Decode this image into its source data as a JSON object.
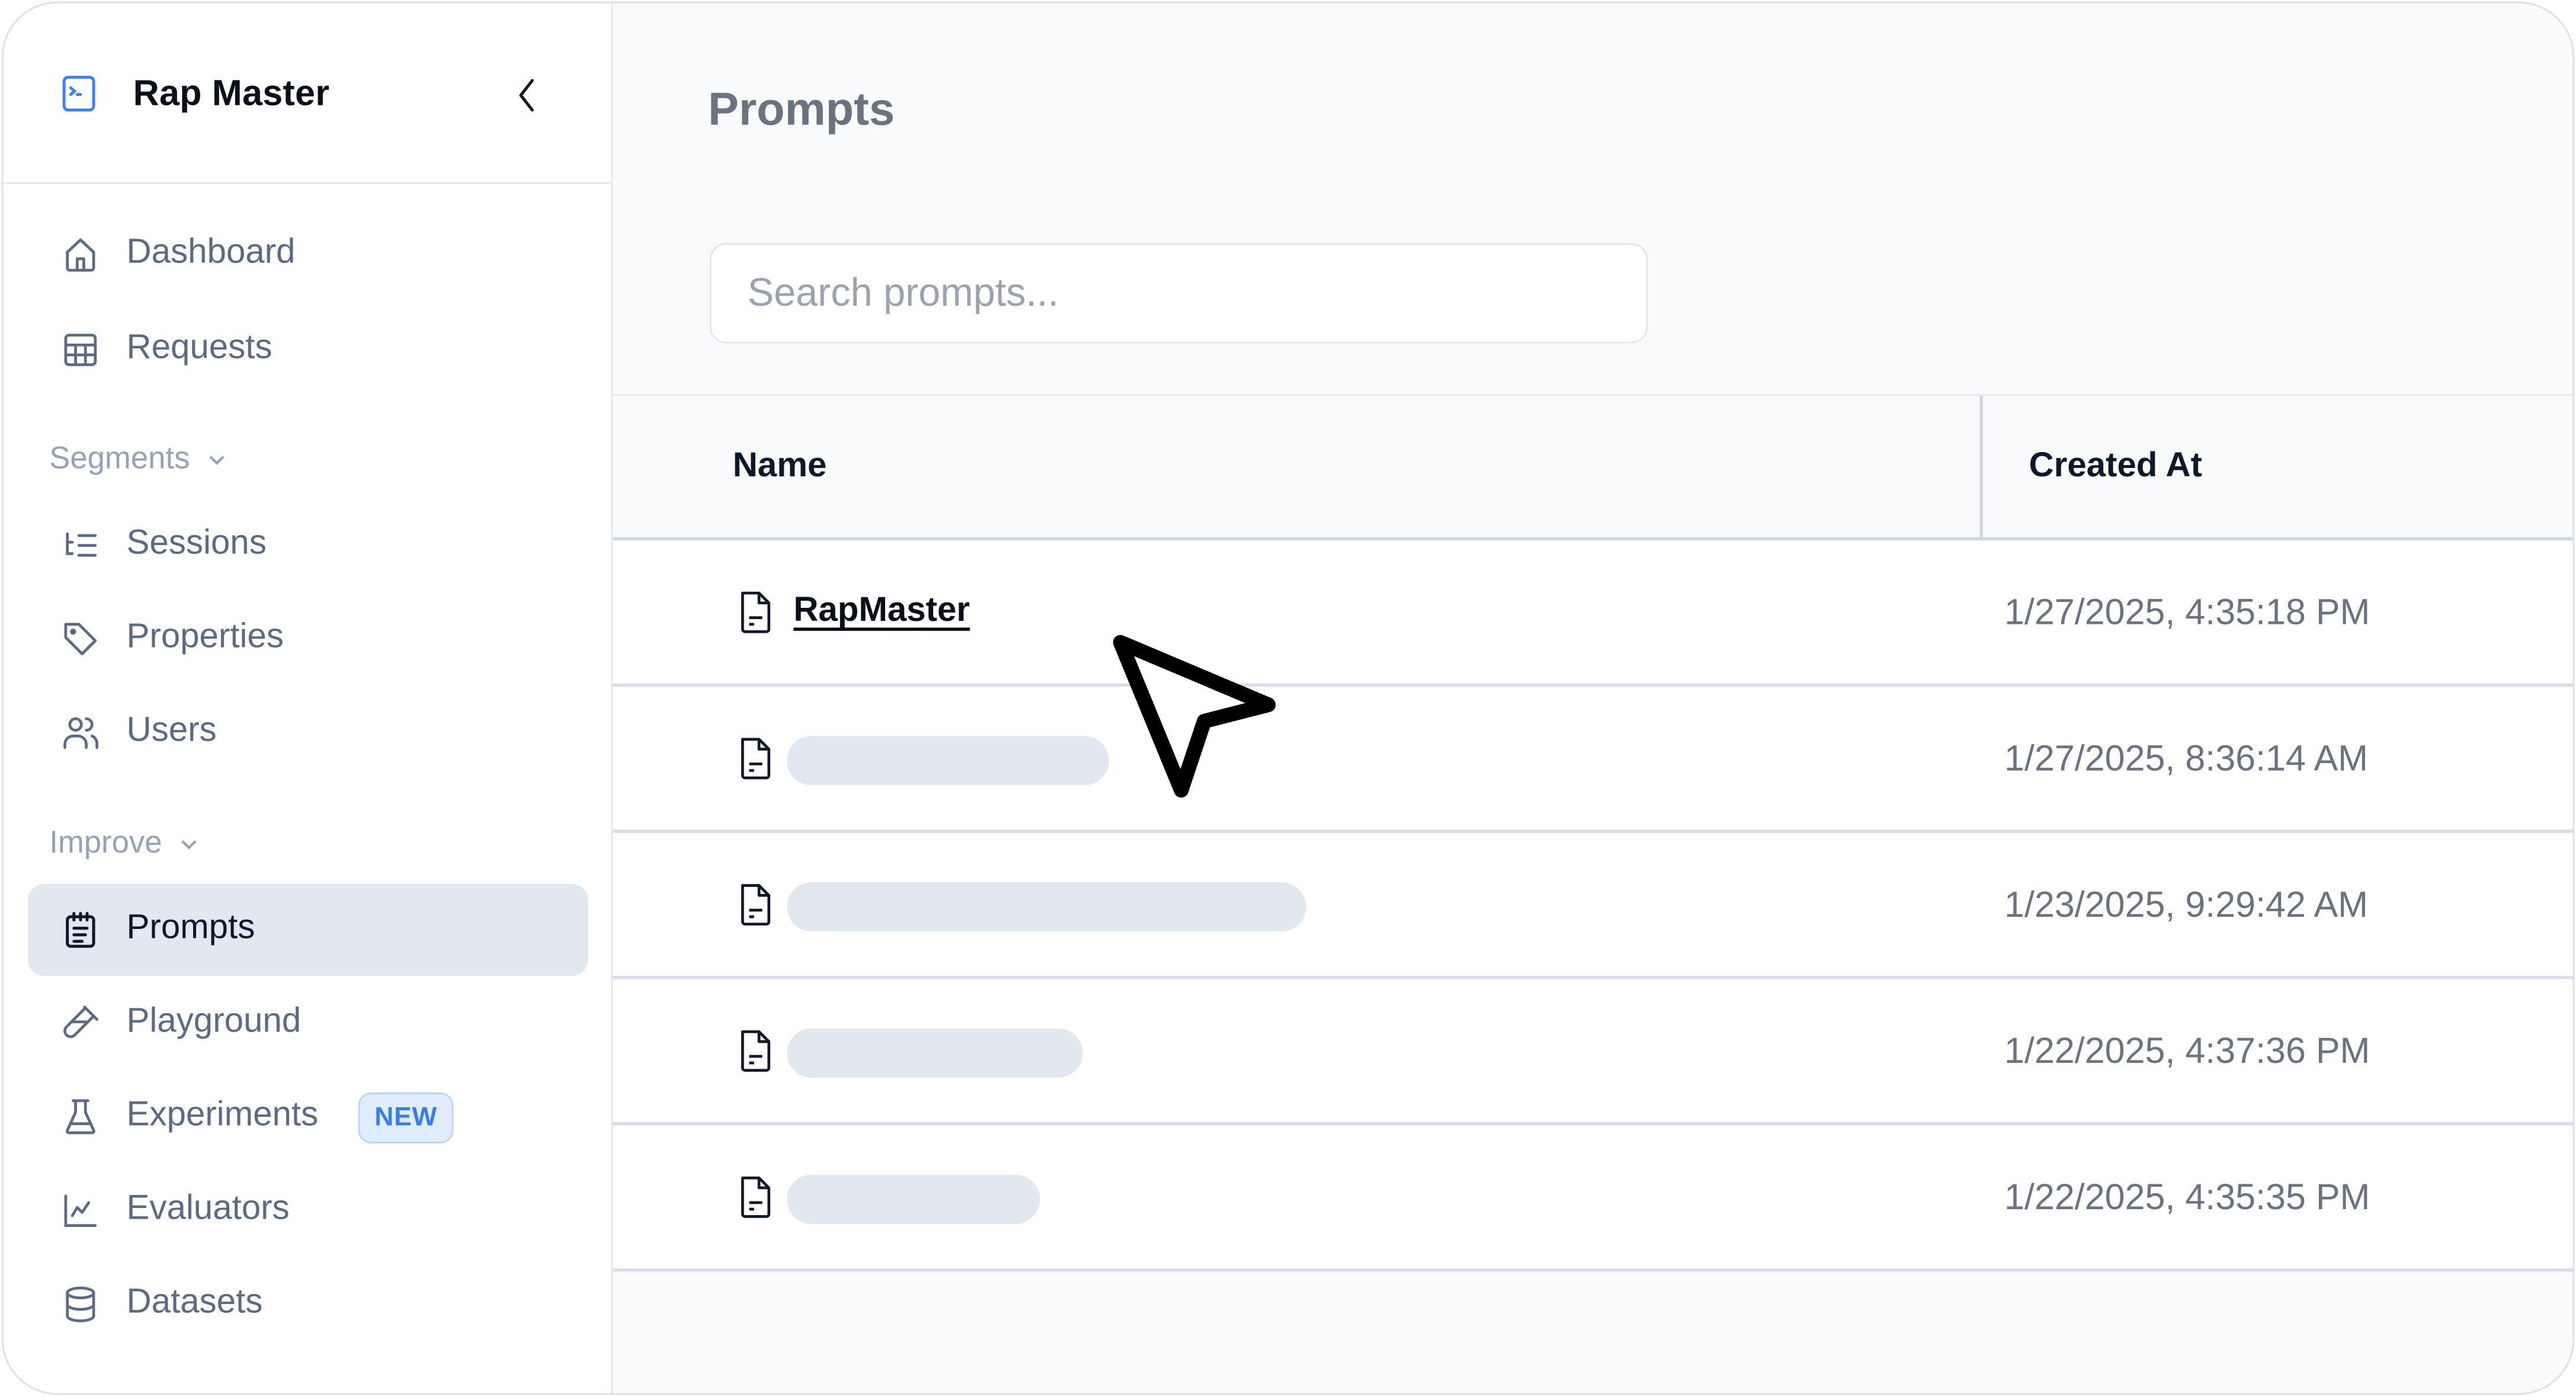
{
  "sidebar": {
    "brand": {
      "name": "Rap Master",
      "icon": "terminal-icon",
      "accent": "#3b82f6"
    },
    "collapse_icon": "chevron-left-icon",
    "items": [
      {
        "label": "Dashboard",
        "icon": "home-icon"
      },
      {
        "label": "Requests",
        "icon": "table-icon"
      },
      {
        "label": "Sessions",
        "icon": "list-tree-icon"
      },
      {
        "label": "Properties",
        "icon": "tag-icon"
      },
      {
        "label": "Users",
        "icon": "users-icon"
      },
      {
        "label": "Prompts",
        "icon": "notepad-icon",
        "active": true
      },
      {
        "label": "Playground",
        "icon": "test-tube-icon"
      },
      {
        "label": "Experiments",
        "icon": "flask-icon",
        "badge": "NEW"
      },
      {
        "label": "Evaluators",
        "icon": "line-chart-icon"
      },
      {
        "label": "Datasets",
        "icon": "database-icon"
      }
    ],
    "sections": [
      {
        "label": "Segments"
      },
      {
        "label": "Improve"
      }
    ]
  },
  "main": {
    "title": "Prompts",
    "search": {
      "placeholder": "Search prompts...",
      "value": ""
    },
    "table": {
      "columns": [
        "Name",
        "Created At"
      ],
      "rows": [
        {
          "name": "RapMaster",
          "created_at": "1/27/2025, 4:35:18 PM",
          "loading": false
        },
        {
          "name": "",
          "created_at": "1/27/2025, 8:36:14 AM",
          "loading": true
        },
        {
          "name": "",
          "created_at": "1/23/2025, 9:29:42 AM",
          "loading": true
        },
        {
          "name": "",
          "created_at": "1/22/2025, 4:37:36 PM",
          "loading": true
        },
        {
          "name": "",
          "created_at": "1/22/2025, 4:35:35 PM",
          "loading": true
        }
      ]
    }
  },
  "colors": {
    "active_nav_bg": "#e2e8f0",
    "badge_text": "#3b7ce6",
    "badge_bg": "#e0ecff",
    "skeleton": "#e2e8f0"
  }
}
